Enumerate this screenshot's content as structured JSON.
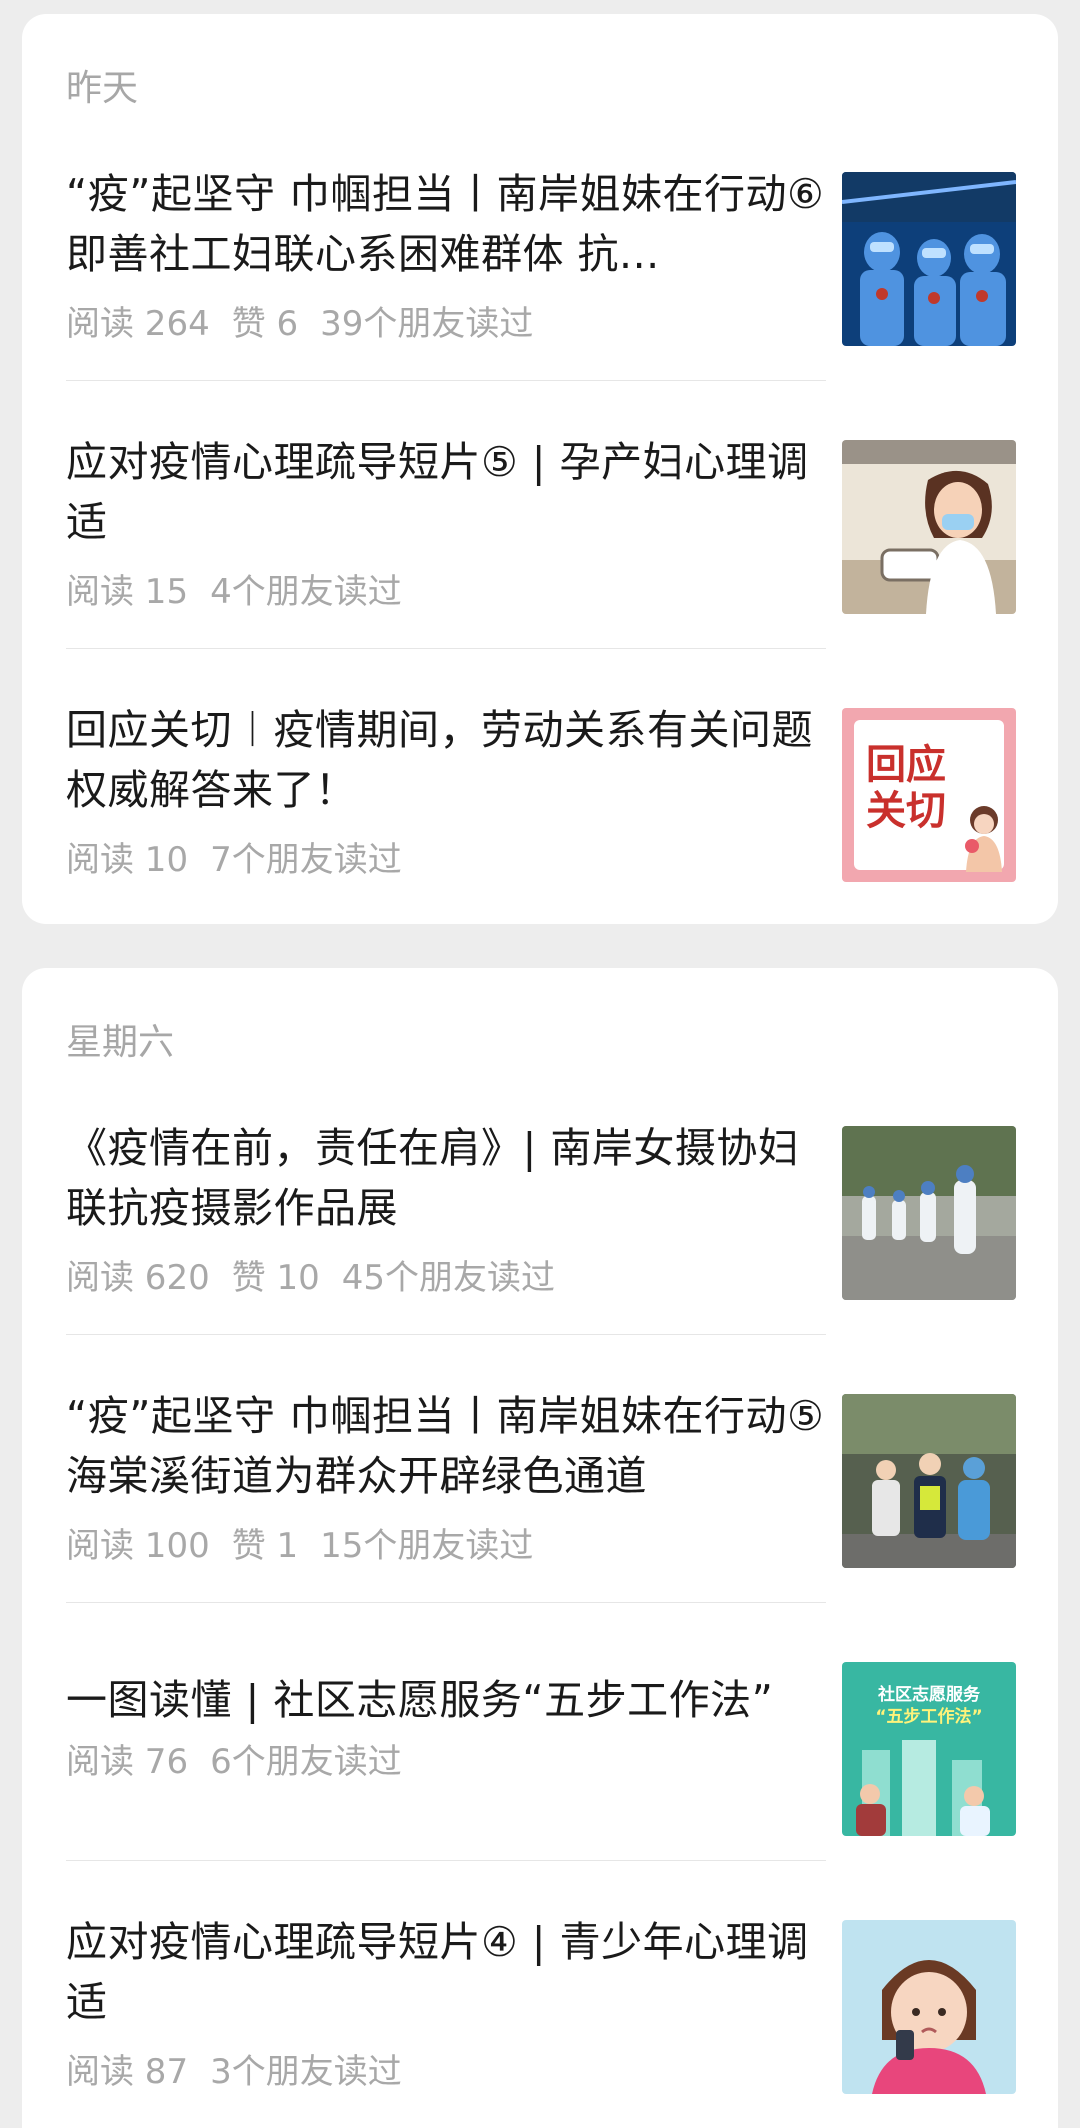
{
  "sections": [
    {
      "date": "昨天",
      "articles": [
        {
          "title": "“疫”起坚守 巾帼担当丨南岸姐妹在行动⑥ 即善社工妇联心系困难群体 抗...",
          "reads": "阅读 264",
          "likes": "赞 6",
          "friends": "39个朋友读过",
          "thumb_colors": [
            "#1d5aa8",
            "#2f7fd6"
          ]
        },
        {
          "title": "应对疫情心理疏导短片⑤ | 孕产妇心理调适",
          "reads": "阅读 15",
          "friends": "4个朋友读过",
          "thumb_colors": [
            "#e8e1d4",
            "#c9b9a2"
          ]
        },
        {
          "title": "回应关切︱疫情期间，劳动关系有关问题权威解答来了！",
          "reads": "阅读 10",
          "friends": "7个朋友读过",
          "thumb_colors": [
            "#f0a0a8",
            "#ffffff"
          ],
          "thumb_text": [
            "回应",
            "关切"
          ]
        }
      ]
    },
    {
      "date": "星期六",
      "articles": [
        {
          "title": "《疫情在前，责任在肩》| 南岸女摄协妇联抗疫摄影作品展",
          "reads": "阅读 620",
          "likes": "赞 10",
          "friends": "45个朋友读过",
          "thumb_colors": [
            "#6a7a5a",
            "#9aa08c"
          ]
        },
        {
          "title": "“疫”起坚守 巾帼担当丨南岸姐妹在行动⑤ 海棠溪街道为群众开辟绿色通道",
          "reads": "阅读 100",
          "likes": "赞 1",
          "friends": "15个朋友读过",
          "thumb_colors": [
            "#5e6b57",
            "#3b6ea8"
          ]
        },
        {
          "title": "一图读懂 | 社区志愿服务“五步工作法”",
          "reads": "阅读 76",
          "friends": "6个朋友读过",
          "thumb_colors": [
            "#2fb3a0",
            "#7fd6c4"
          ],
          "thumb_text": [
            "社区志愿服务",
            "“五步工作法”"
          ]
        },
        {
          "title": "应对疫情心理疏导短片④ | 青少年心理调适",
          "reads": "阅读 87",
          "friends": "3个朋友读过",
          "thumb_colors": [
            "#bfe6f2",
            "#e85a8a"
          ]
        }
      ]
    }
  ]
}
